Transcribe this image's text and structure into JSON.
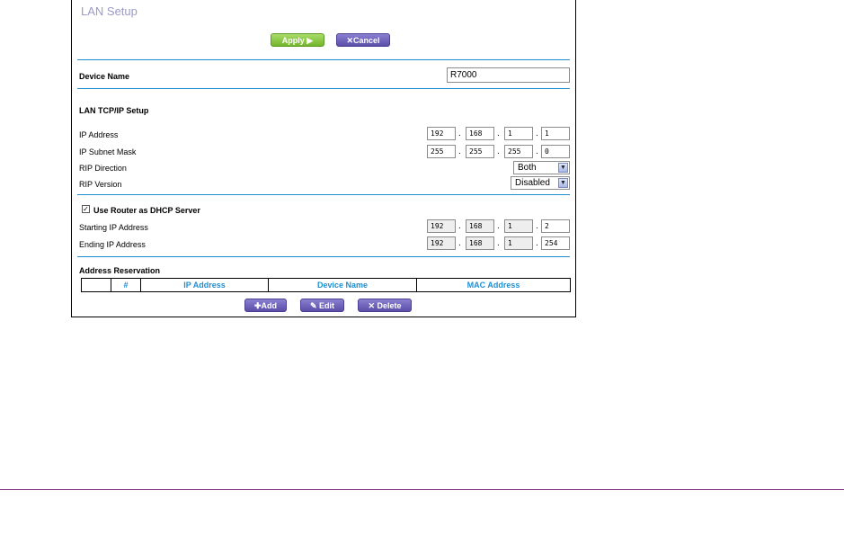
{
  "page": {
    "title": "LAN Setup"
  },
  "toolbar": {
    "apply_label": "Apply ▶",
    "cancel_label": "✕Cancel"
  },
  "device": {
    "label": "Device Name",
    "value": "R7000"
  },
  "tcpip": {
    "section_label": "LAN TCP/IP Setup",
    "ip_label": "IP Address",
    "ip": [
      "192",
      "168",
      "1",
      "1"
    ],
    "mask_label": "IP Subnet Mask",
    "mask": [
      "255",
      "255",
      "255",
      "0"
    ],
    "rip_dir_label": "RIP Direction",
    "rip_dir_value": "Both",
    "rip_ver_label": "RIP Version",
    "rip_ver_value": "Disabled"
  },
  "dhcp": {
    "checkbox_label": "Use Router as DHCP Server",
    "checked": true,
    "start_label": "Starting IP Address",
    "start": [
      "192",
      "168",
      "1",
      "2"
    ],
    "end_label": "Ending IP Address",
    "end": [
      "192",
      "168",
      "1",
      "254"
    ]
  },
  "reservation": {
    "section_label": "Address Reservation",
    "columns": [
      "",
      "#",
      "IP Address",
      "Device Name",
      "MAC Address"
    ],
    "add_label": "✚Add",
    "edit_label": "✎ Edit",
    "delete_label": "✕ Delete"
  },
  "colors": {
    "accent_blue": "#1f8fd0",
    "apply_green": "#73b52c",
    "button_purple": "#5a4ea8",
    "footer_line": "#7b2b7b"
  }
}
